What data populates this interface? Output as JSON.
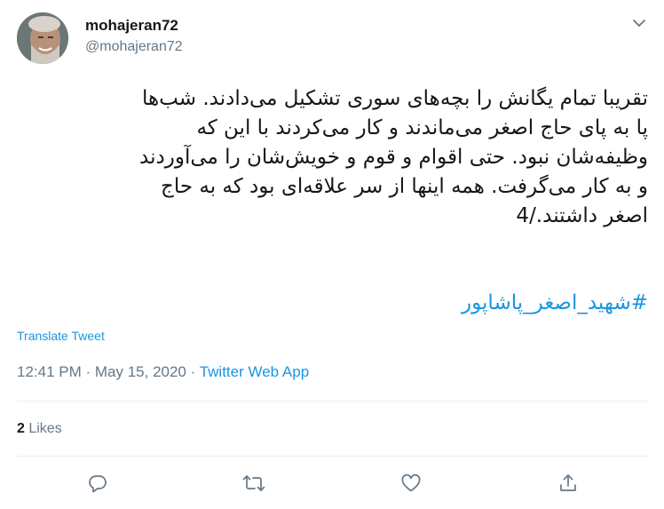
{
  "author": {
    "display_name": "mohajeran72",
    "handle": "@mohajeran72",
    "avatar_icon": "user-avatar"
  },
  "tweet": {
    "text": "تقریبا تمام یگانش را بچه‌های سوری تشکیل می‌دادند. شب‌ها\nپا به پای حاج اصغر می‌ماندند و کار می‌کردند با این که\nوظیفه‌شان نبود. حتی اقوام و قوم و خویش‌شان را می‌آوردند\nو به کار می‌گرفت. همه اینها از سر علاقه‌ای بود که به حاج\nاصغر داشتند./4",
    "hashtag": "#شهید_اصغر_پاشاپور",
    "translate_label": "Translate Tweet"
  },
  "meta": {
    "time": "12:41 PM",
    "separator": " · ",
    "date": "May 15, 2020",
    "source": "Twitter Web App"
  },
  "engagement": {
    "likes_count": "2",
    "likes_label": " Likes"
  },
  "actions": [
    "reply-icon",
    "retweet-icon",
    "like-icon",
    "share-icon"
  ],
  "colors": {
    "link": "#1b95e0",
    "secondary": "#657786",
    "border": "#e6ecf0",
    "text": "#14171a"
  }
}
